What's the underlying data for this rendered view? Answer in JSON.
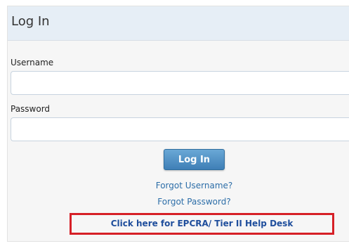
{
  "header": {
    "title": "Log In"
  },
  "form": {
    "username_label": "Username",
    "username_value": "",
    "password_label": "Password",
    "password_value": "",
    "login_button": "Log In"
  },
  "links": {
    "forgot_username": "Forgot Username?",
    "forgot_password": "Forgot Password?",
    "helpdesk": "Click here for EPCRA/ Tier II Help Desk"
  },
  "colors": {
    "header_bg": "#e6eef6",
    "link": "#2d6ea8",
    "helpdesk_link": "#1f4e9c",
    "highlight_box": "#d62027",
    "button": "#3f7fb6"
  }
}
